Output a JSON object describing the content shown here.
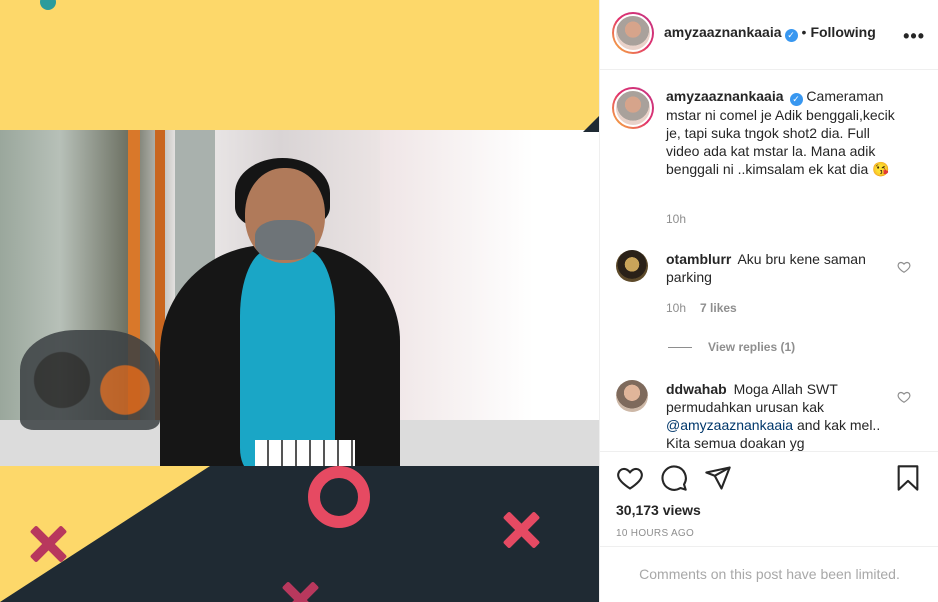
{
  "post": {
    "username": "amyzaaznankaaia",
    "separator": "•",
    "follow_status": "Following",
    "more_label": "•••"
  },
  "caption": {
    "username": "amyzaaznankaaia",
    "text": "Cameraman mstar ni comel je Adik benggali,kecik je, tapi suka tngok shot2 dia. Full video ada kat mstar la. Mana adik benggali ni ..kimsalam ek kat dia 😘",
    "time": "10h"
  },
  "comments": [
    {
      "username": "otamblurr",
      "text": "Aku bru kene saman parking",
      "time": "10h",
      "likes": "7 likes",
      "view_replies": "View replies (1)"
    },
    {
      "username": "ddwahab",
      "text_before": "Moga Allah SWT permudahkan urusan kak",
      "mention": "@amyzaaznankaaia",
      "text_after": "and kak mel.. Kita semua doakan yg"
    }
  ],
  "stats": {
    "views": "30,173 views",
    "posted": "10 HOURS AGO"
  },
  "comments_notice": "Comments on this post have been limited.",
  "icons": {
    "verified": "verified-badge-icon",
    "like": "heart-icon",
    "comment": "comment-icon",
    "share": "paper-plane-icon",
    "save": "bookmark-icon",
    "more": "more-options-icon"
  },
  "colors": {
    "accent_blue": "#3897f0",
    "muted": "#8e8e8e",
    "mention": "#00376b",
    "media_yellow": "#fdd86a",
    "media_dark": "#1f2a33",
    "shirt_cyan": "#1aa6c6",
    "shape_pink": "#e64a62"
  }
}
